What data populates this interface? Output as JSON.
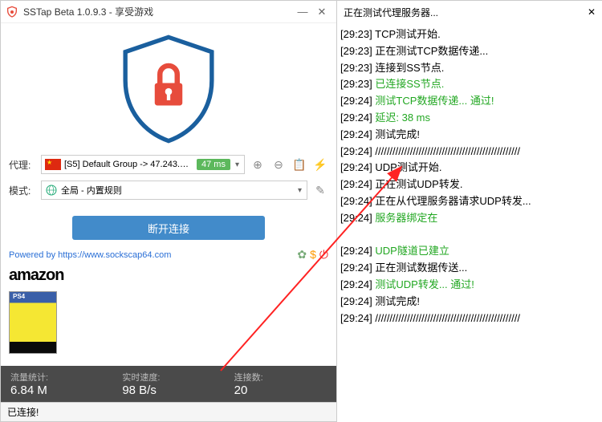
{
  "window": {
    "title": "SSTap Beta 1.0.9.3 - 享受游戏"
  },
  "proxy": {
    "label": "代理:",
    "text": "[S5] Default Group -> 47.243.19...",
    "latency": "47 ms"
  },
  "mode": {
    "label": "模式:",
    "text": "全局 - 内置规则"
  },
  "connect_label": "断开连接",
  "footer_link": "Powered by https://www.sockscap64.com",
  "sponsor": {
    "brand": "amazon"
  },
  "stats": {
    "traffic_label": "流量统计:",
    "traffic_value": "6.84 M",
    "speed_label": "实时速度:",
    "speed_value": "98 B/s",
    "conn_label": "连接数:",
    "conn_value": "20"
  },
  "status": "已连接!",
  "log_header": "正在测试代理服务器...",
  "log_lines": [
    {
      "ts": "[29:23]",
      "msg": "TCP测试开始.",
      "color": "black"
    },
    {
      "ts": "[29:23]",
      "msg": "正在测试TCP数据传递...",
      "color": "black"
    },
    {
      "ts": "[29:23]",
      "msg": "连接到SS节点.",
      "color": "black"
    },
    {
      "ts": "[29:23]",
      "msg": "已连接SS节点.",
      "color": "green"
    },
    {
      "ts": "[29:24]",
      "msg": "测试TCP数据传递... 通过!",
      "color": "green"
    },
    {
      "ts": "[29:24]",
      "msg": "延迟: 38 ms",
      "color": "green"
    },
    {
      "ts": "[29:24]",
      "msg": "测试完成!",
      "color": "black"
    },
    {
      "ts": "[29:24]",
      "msg": "//////////////////////////////////////////////////",
      "color": "black"
    },
    {
      "ts": "[29:24]",
      "msg": "UDP测试开始.",
      "color": "black"
    },
    {
      "ts": "[29:24]",
      "msg": "正在测试UDP转发.",
      "color": "black"
    },
    {
      "ts": "[29:24]",
      "msg": "正在从代理服务器请求UDP转发...",
      "color": "black"
    },
    {
      "ts": "[29:24]",
      "msg": "服务器绑定在",
      "color": "green"
    },
    {
      "ts": "",
      "msg": " ",
      "color": "black"
    },
    {
      "ts": "[29:24]",
      "msg": "UDP隧道已建立",
      "color": "green"
    },
    {
      "ts": "[29:24]",
      "msg": "正在测试数据传送...",
      "color": "black"
    },
    {
      "ts": "[29:24]",
      "msg": "测试UDP转发... 通过!",
      "color": "green"
    },
    {
      "ts": "[29:24]",
      "msg": "测试完成!",
      "color": "black"
    },
    {
      "ts": "[29:24]",
      "msg": "//////////////////////////////////////////////////",
      "color": "black"
    }
  ]
}
